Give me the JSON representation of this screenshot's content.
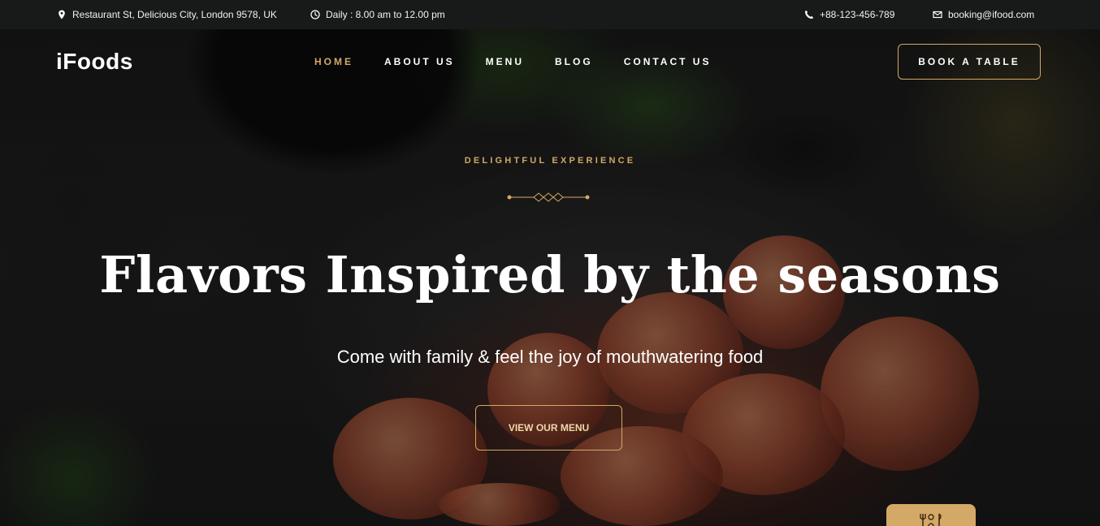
{
  "topbar": {
    "address": "Restaurant St, Delicious City, London 9578, UK",
    "hours": "Daily : 8.00 am to 12.00 pm",
    "phone": "+88-123-456-789",
    "email": "booking@ifood.com",
    "icons": {
      "address": "location-pin-icon",
      "hours": "clock-icon",
      "phone": "phone-icon",
      "email": "envelope-icon"
    }
  },
  "header": {
    "logo": "iFoods",
    "nav": [
      {
        "label": "HOME",
        "active": true
      },
      {
        "label": "ABOUT US",
        "active": false
      },
      {
        "label": "MENU",
        "active": false
      },
      {
        "label": "BLOG",
        "active": false
      },
      {
        "label": "CONTACT US",
        "active": false
      }
    ],
    "cta": "BOOK A TABLE"
  },
  "hero": {
    "eyebrow": "DELIGHTFUL EXPERIENCE",
    "title": "Flavors Inspired by the seasons",
    "subtitle": "Come with family & feel the joy of mouthwatering food",
    "button": "VIEW OUR MENU"
  },
  "badge": {
    "icon": "dining-icon"
  },
  "colors": {
    "accent": "#d4a866",
    "topbar": "#171a19",
    "text": "#ffffff"
  }
}
